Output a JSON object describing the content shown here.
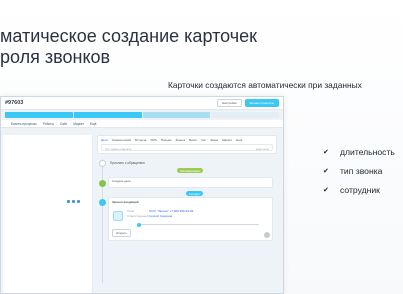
{
  "slide": {
    "title_line1": "матическое создание карточек",
    "title_line2": "роля звонков",
    "subtitle": "Карточки создаются автоматически при заданных",
    "features": [
      "длительность",
      "тип звонка",
      "сотрудник"
    ],
    "check_icon": "check-icon"
  },
  "crm": {
    "deal_title": "#97603",
    "deal_title_suffix": "",
    "top_buttons": [
      "Настройки",
      "Бизнес-процессы"
    ],
    "stages": [
      {
        "label": "",
        "color": "#3bc8f5"
      },
      {
        "label": "",
        "color": "#3bc8f5"
      },
      {
        "label": "",
        "color": "#a8dff0"
      },
      {
        "label": "",
        "color": "#e5eef4"
      }
    ],
    "tabs": [
      "",
      "Бизнес-процессы",
      "Роботы",
      "Сайт",
      "Маркет",
      "Ещё"
    ],
    "left_lines": [
      "",
      "",
      "",
      ""
    ],
    "left_bottom": [
      "",
      ""
    ],
    "composer_tabs": [
      "Дело",
      "Комментарий",
      "Встреча",
      "SMS",
      "Письмо",
      "Звонок",
      "Визит",
      "Чат",
      "Заказ",
      "Маркет",
      "Ещё"
    ],
    "composer_placeholder": "Что нужно сделать",
    "composer_more": "ещё поле",
    "feed_item1": "Прислать к обращению",
    "pill_planned": "Запланировано",
    "pill_today": "Сегодня",
    "task_title": "Создать дело",
    "task_desc": "",
    "call_title": "Звонок входящий",
    "call_lines": [
      "Тема",
      "ООО \"Звонок\" +7 999 999-99-99",
      "Ответственный",
      "Сергей Смирнов"
    ],
    "open_button": "Открыть"
  }
}
